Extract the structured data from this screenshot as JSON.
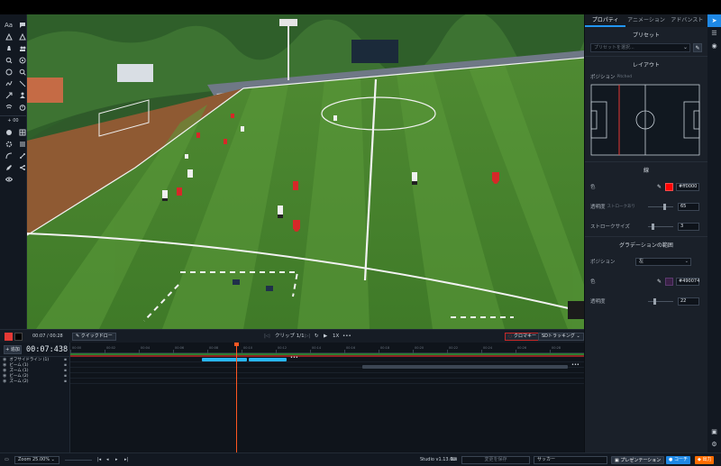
{
  "left_toolbar": {
    "text_tool": "Aa",
    "zoom_label": "+ 00"
  },
  "right_panel": {
    "tabs": [
      "プロパティ",
      "アニメーション",
      "アドバンスト"
    ],
    "preset_header": "プリセット",
    "preset_placeholder": "プリセットを選択...",
    "layout_header": "レイアウト",
    "position_label": "ポジション",
    "position_tag": "Pitched",
    "line_header": "線",
    "color_label": "色",
    "color_value": "#ff0000",
    "opacity_label": "透明度",
    "opacity_tag": "ストロークあり",
    "opacity_value": "65",
    "stroke_label": "ストロークサイズ",
    "stroke_value": "3",
    "gradient_header": "グラデーションの範囲",
    "grad_position_label": "ポジション",
    "grad_position_value": "左",
    "grad_color_label": "色",
    "grad_color_value": "#490074",
    "grad_opacity_label": "透明度",
    "grad_opacity_value": "22"
  },
  "control_bar": {
    "time_readout": "00:07 / 00:28",
    "quick_draw": "クイックドロー",
    "clip_label": "クリップ 1/1",
    "speed": "1X",
    "chroma_key": "クロマキー",
    "tracking": "SDトラッキング"
  },
  "timeline": {
    "add_button": "+ 追加",
    "timecode": "00:07:438",
    "tracks": [
      "オフサイドライン (1)",
      "ビーム (1)",
      "ズーム (1)",
      "ビーム (2)",
      "ズーム (2)"
    ],
    "ruler_labels": [
      "00:00",
      "00:02",
      "00:04",
      "00:06",
      "00:08",
      "00:10",
      "00:12",
      "00:14",
      "00:16",
      "00:18",
      "00:20",
      "00:22",
      "00:24",
      "00:26",
      "00:28"
    ]
  },
  "status_bar": {
    "zoom": "Zoom 25.00%",
    "version": "Studio v1.13.0",
    "save_placeholder": "変更を保存",
    "sport": "サッカー",
    "presentation": "プレゼンテーション",
    "coach": "コーチ",
    "export": "出力"
  },
  "colors": {
    "accent": "#2196f3",
    "line_color": "#ff0000",
    "playhead": "#ff5722",
    "export_button": "#ff6d00"
  }
}
